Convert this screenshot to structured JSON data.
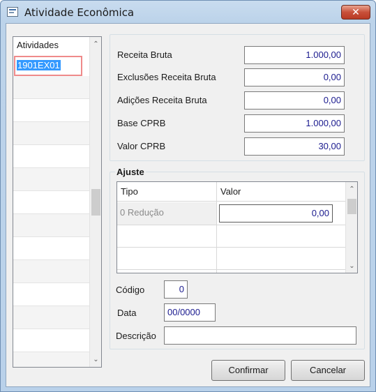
{
  "window": {
    "title": "Atividade Econômica",
    "close_label": "✕"
  },
  "activities": {
    "header": "Atividades",
    "items": [
      "1901EX01"
    ],
    "scroll_up": "⌃",
    "scroll_down": "⌄"
  },
  "totals": {
    "receita_bruta": {
      "label": "Receita Bruta",
      "value": "1.000,00"
    },
    "exclusoes": {
      "label": "Exclusões Receita Bruta",
      "value": "0,00"
    },
    "adicoes": {
      "label": "Adições Receita Bruta",
      "value": "0,00"
    },
    "base_cprb": {
      "label": "Base CPRB",
      "value": "1.000,00"
    },
    "valor_cprb": {
      "label": "Valor CPRB",
      "value": "30,00"
    }
  },
  "ajuste": {
    "title": "Ajuste",
    "columns": [
      "Tipo",
      "Valor"
    ],
    "rows": [
      {
        "tipo": "0 Redução",
        "valor": "0,00"
      }
    ],
    "codigo": {
      "label": "Código",
      "value": "0"
    },
    "data": {
      "label": "Data",
      "value": "00/0000"
    },
    "descricao": {
      "label": "Descrição",
      "value": ""
    }
  },
  "buttons": {
    "confirm": "Confirmar",
    "cancel": "Cancelar"
  },
  "colors": {
    "selection": "#3399ff",
    "value_text": "#1a1a8e",
    "close_button": "#c8503a"
  }
}
